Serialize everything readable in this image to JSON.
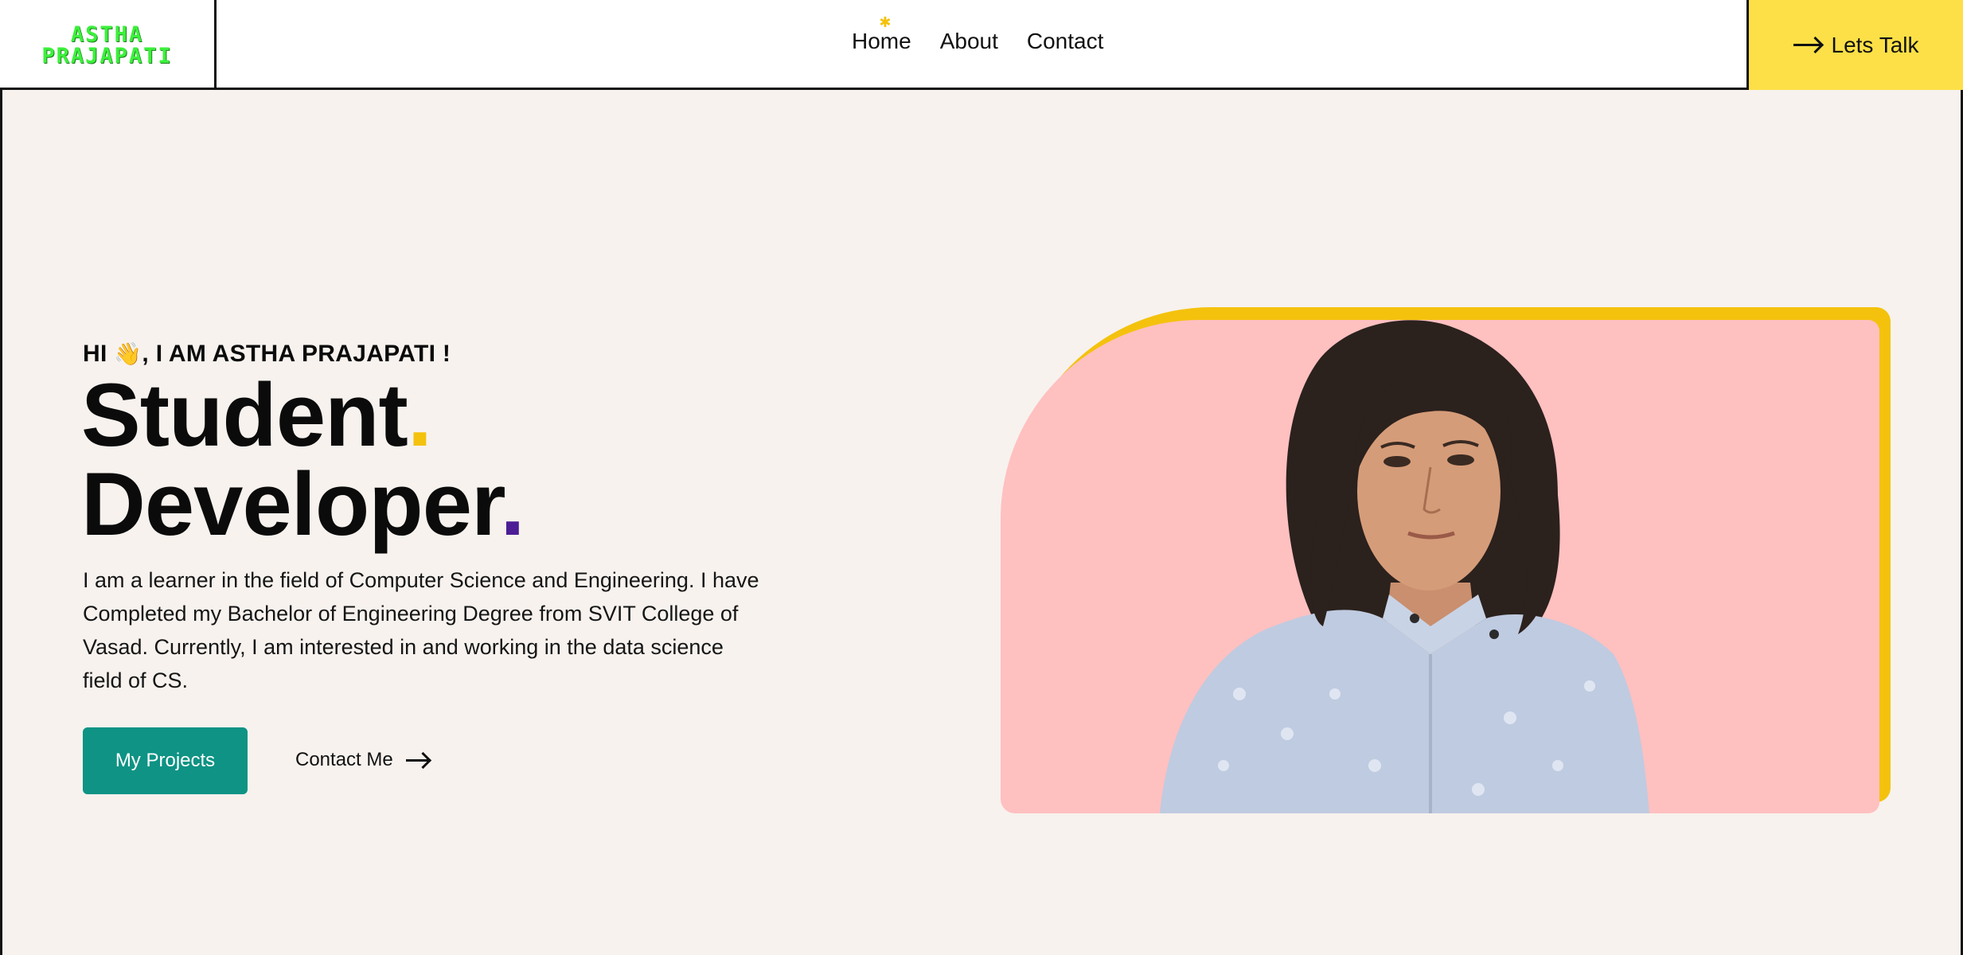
{
  "header": {
    "logo_line1": "ASTHA",
    "logo_line2": "PRAJAPATI",
    "nav": [
      {
        "label": "Home",
        "active": true
      },
      {
        "label": "About"
      },
      {
        "label": "Contact"
      }
    ],
    "cta_label": "Lets Talk"
  },
  "hero": {
    "greeting_prefix": "HI",
    "greeting_emoji": "👋",
    "greeting_suffix": ", I AM ASTHA PRAJAPATI !",
    "headline_line1": "Student",
    "headline_line2": "Developer",
    "dot": ".",
    "description": "I am a learner in the field of Computer Science and Engineering. I have Completed my Bachelor of Engineering Degree from SVIT College of Vasad. Currently, I am interested in and working in the data science field of CS.",
    "primary_button": "My Projects",
    "secondary_link": "Contact Me"
  },
  "colors": {
    "background": "#f7f2ee",
    "cta": "#fde047",
    "accent_yellow": "#f4c20d",
    "accent_purple": "#4c1d95",
    "primary_button": "#0e9384",
    "card_bg": "#ffc0c0",
    "logo_green": "#3cf03c"
  },
  "icons": {
    "nav_active_marker": "star-icon",
    "arrow": "arrow-right-icon",
    "wave": "waving-hand-icon"
  }
}
